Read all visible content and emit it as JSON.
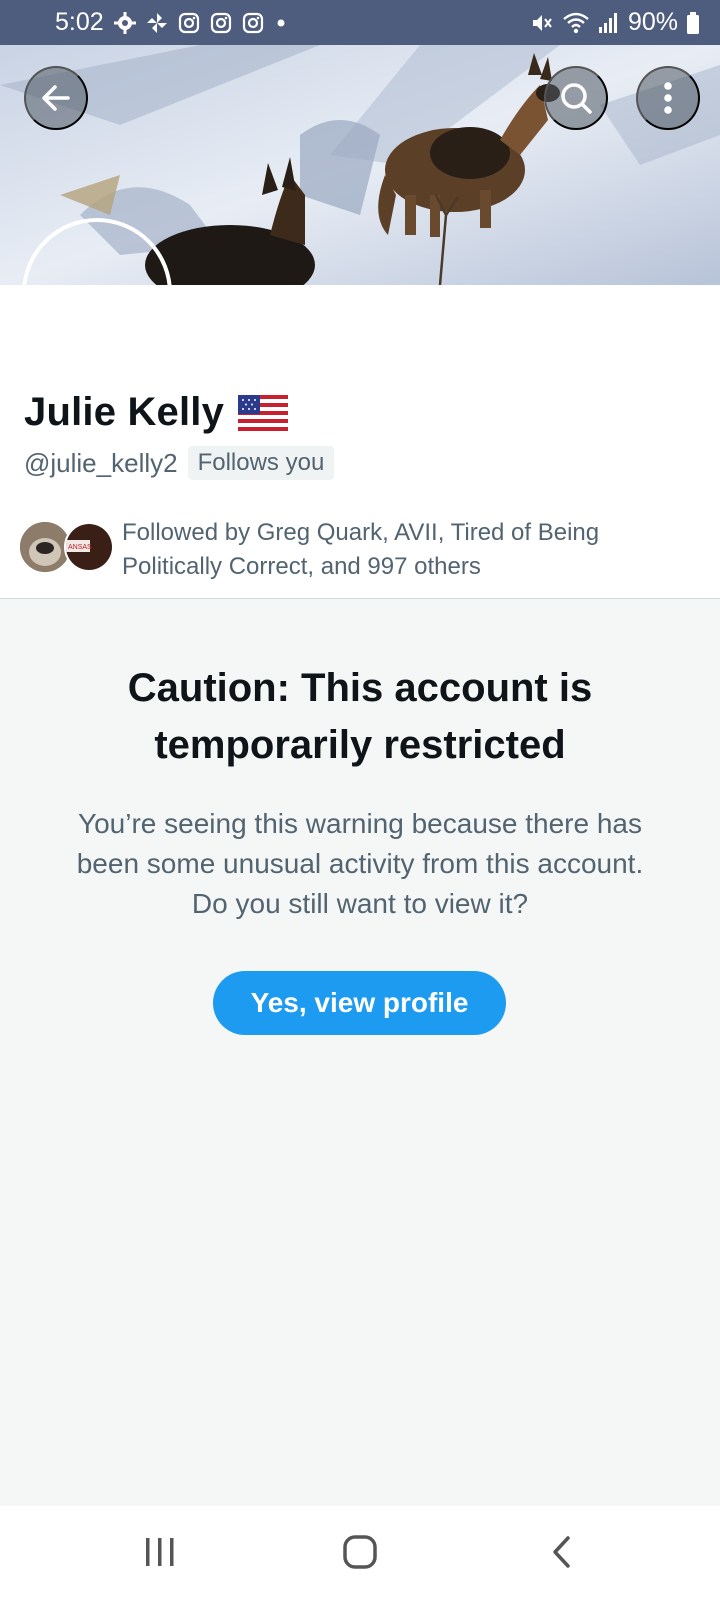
{
  "status_bar": {
    "time": "5:02",
    "battery": "90%",
    "icons": [
      "settings-icon",
      "pinwheel-icon",
      "instagram-icon",
      "instagram-icon",
      "instagram-icon",
      "dot-icon",
      "mute-icon",
      "wifi-icon",
      "signal-icon",
      "battery-icon"
    ]
  },
  "header": {
    "back_icon": "arrow-left-icon",
    "search_icon": "search-icon",
    "more_icon": "more-vertical-icon"
  },
  "profile": {
    "display_name": "Julie Kelly",
    "flag_icon": "us-flag-icon",
    "handle": "@julie_kelly2",
    "follows_you": "Follows you",
    "followed_by": "Followed by Greg Quark, AVII, Tired of Being Politically Correct, and 997 others"
  },
  "warning": {
    "title": "Caution: This account is temporarily restricted",
    "body": "You’re seeing this warning because there has been some unusual activity from this account. Do you still want to view it?",
    "button_label": "Yes, view profile"
  },
  "colors": {
    "status_bar": "#4e5c7e",
    "accent": "#1d9bf0",
    "secondary_text": "#536471",
    "primary_text": "#0f1419",
    "background": "#f5f7f7"
  },
  "nav_bar": {
    "icons": [
      "recent-apps-icon",
      "home-icon",
      "back-icon"
    ]
  }
}
